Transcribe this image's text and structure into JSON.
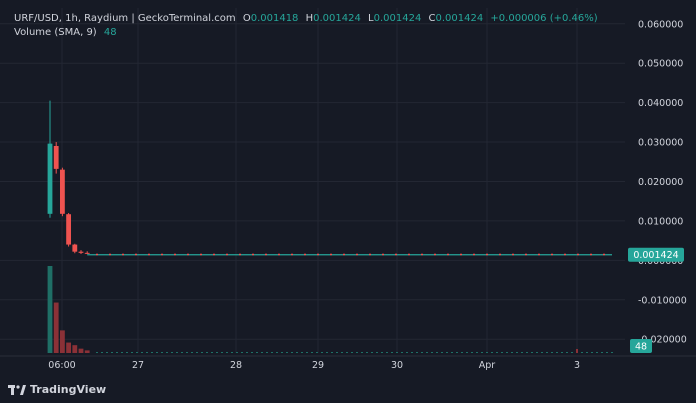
{
  "header": {
    "symbol_line": "URF/USD, 1h, Raydium | GeckoTerminal.com",
    "o_label": "O",
    "o_value": "0.001418",
    "h_label": "H",
    "h_value": "0.001424",
    "l_label": "L",
    "l_value": "0.001424",
    "c_label": "C",
    "c_value": "0.001424",
    "change": "+0.000006 (+0.46%)",
    "volume_label": "Volume (SMA, 9)",
    "volume_value": "48"
  },
  "branding": {
    "name": "TradingView"
  },
  "colors": {
    "background": "#161a25",
    "up": "#26a69a",
    "down": "#ef5350",
    "up_volume": "#1f6f66",
    "down_volume": "#8b3137",
    "grid": "#232733",
    "text": "#d1d4dc"
  },
  "chart_data": {
    "type": "candlestick",
    "x_ticks": [
      "06:00",
      "27",
      "28",
      "29",
      "30",
      "Apr",
      "3"
    ],
    "price_axis": {
      "ticks": [
        "0.060000",
        "0.050000",
        "0.040000",
        "0.030000",
        "0.020000",
        "0.010000",
        "0.000000",
        "-0.010000",
        "-0.020000"
      ],
      "ylim": [
        -0.0235,
        0.064
      ],
      "last_price_label": "0.001424"
    },
    "candles": [
      {
        "t": 0,
        "o": 0.0118,
        "h": 0.0405,
        "l": 0.0108,
        "c": 0.0296
      },
      {
        "t": 1,
        "o": 0.029,
        "h": 0.03,
        "l": 0.022,
        "c": 0.0232
      },
      {
        "t": 2,
        "o": 0.023,
        "h": 0.0235,
        "l": 0.0112,
        "c": 0.0118
      },
      {
        "t": 3,
        "o": 0.0117,
        "h": 0.012,
        "l": 0.0035,
        "c": 0.004
      },
      {
        "t": 4,
        "o": 0.004,
        "h": 0.0042,
        "l": 0.0018,
        "c": 0.0022
      },
      {
        "t": 5,
        "o": 0.0022,
        "h": 0.0026,
        "l": 0.0016,
        "c": 0.0019
      },
      {
        "t": 6,
        "o": 0.0019,
        "h": 0.0023,
        "l": 0.0016,
        "c": 0.0018
      }
    ],
    "tail_price": 0.001424,
    "volume": {
      "last_label": "48",
      "bars": [
        {
          "t": 0,
          "v": 1.0,
          "dir": "up"
        },
        {
          "t": 1,
          "v": 0.58,
          "dir": "down"
        },
        {
          "t": 2,
          "v": 0.26,
          "dir": "down"
        },
        {
          "t": 3,
          "v": 0.12,
          "dir": "down"
        },
        {
          "t": 4,
          "v": 0.09,
          "dir": "down"
        },
        {
          "t": 5,
          "v": 0.05,
          "dir": "down"
        },
        {
          "t": 6,
          "v": 0.03,
          "dir": "down"
        }
      ]
    }
  }
}
